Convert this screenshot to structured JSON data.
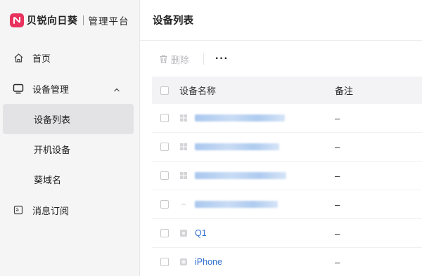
{
  "brand": {
    "name": "贝锐向日葵",
    "subtitle": "管理平台"
  },
  "sidebar": {
    "home": "首页",
    "device_mgmt": "设备管理",
    "sub_items": [
      "设备列表",
      "开机设备",
      "葵域名"
    ],
    "message_sub": "消息订阅"
  },
  "main": {
    "title": "设备列表",
    "toolbar": {
      "delete_label": "删除",
      "more_label": "···"
    },
    "table": {
      "headers": [
        "设备名称",
        "备注"
      ],
      "rows": [
        {
          "name": "",
          "note": "–"
        },
        {
          "name": "",
          "note": "–"
        },
        {
          "name": "",
          "note": "–"
        },
        {
          "name": "",
          "note": "–"
        },
        {
          "name": "Q1",
          "note": "–"
        },
        {
          "name": "iPhone",
          "note": "–"
        }
      ]
    }
  },
  "colors": {
    "brand": "#e8325d",
    "link": "#2f6fd0",
    "sidebar_bg": "#f5f5f6",
    "active_bg": "#e3e3e6"
  }
}
